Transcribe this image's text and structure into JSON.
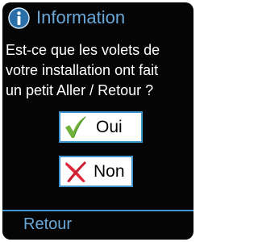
{
  "header": {
    "title": "Information",
    "icon": "info-icon",
    "title_color": "#6aa8d8"
  },
  "question": {
    "lines": [
      "Est-ce que les volets de",
      "votre installation ont fait",
      "un petit Aller / Retour ?"
    ]
  },
  "buttons": {
    "yes": {
      "label": "Oui",
      "icon": "check-icon",
      "icon_color": "#6fb23a"
    },
    "no": {
      "label": "Non",
      "icon": "cross-icon",
      "icon_color": "#e0283a"
    }
  },
  "footer": {
    "back_label": "Retour",
    "accent_color": "#3f95cf"
  }
}
